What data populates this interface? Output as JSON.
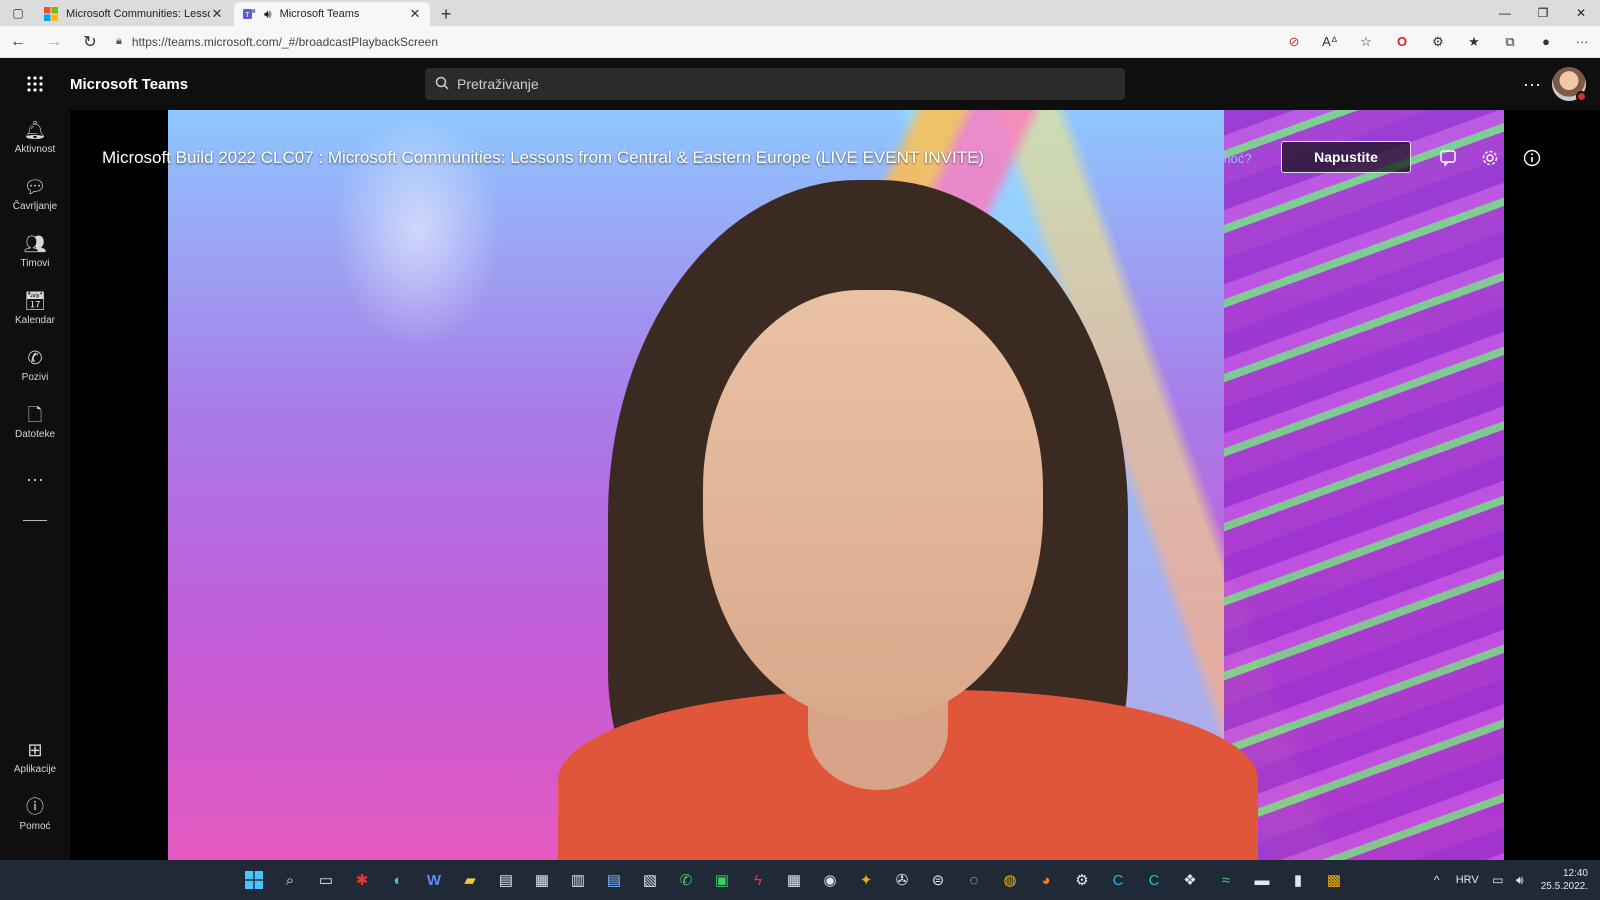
{
  "browser": {
    "tabs": [
      {
        "title": "Microsoft Communities: Lessons",
        "active": false
      },
      {
        "title": "Microsoft Teams",
        "active": true
      }
    ],
    "new_tab_label": "+",
    "url": "https://teams.microsoft.com/_#/broadcastPlaybackScreen"
  },
  "teams": {
    "app_title": "Microsoft Teams",
    "search_placeholder": "Pretraživanje",
    "more_label": "···"
  },
  "rail": {
    "items": [
      {
        "label": "Aktivnost",
        "icon": "bell-icon"
      },
      {
        "label": "Čavrljanje",
        "icon": "chat-icon"
      },
      {
        "label": "Timovi",
        "icon": "teams-icon"
      },
      {
        "label": "Kalendar",
        "icon": "calendar-icon"
      },
      {
        "label": "Pozivi",
        "icon": "phone-icon"
      },
      {
        "label": "Datoteke",
        "icon": "file-icon"
      }
    ],
    "more_label": "···",
    "bottom_items": [
      {
        "label": "Aplikacije",
        "icon": "apps-icon"
      },
      {
        "label": "Pomoć",
        "icon": "help-icon"
      }
    ]
  },
  "event": {
    "title": "Microsoft Build 2022 CLC07 : Microsoft Communities: Lessons from Central & Eastern Europe (LIVE EVENT INVITE)",
    "help_link": "Trebate li pomoć?",
    "leave_button": "Napustite"
  },
  "taskbar": {
    "language": "HRV",
    "time": "12:40",
    "date": "25.5.2022."
  },
  "colors": {
    "teams_bg": "#0f0f0f",
    "taskbar_bg": "#1f2a36",
    "help_link": "#9fb5ff",
    "status_busy": "#d92c2c"
  }
}
